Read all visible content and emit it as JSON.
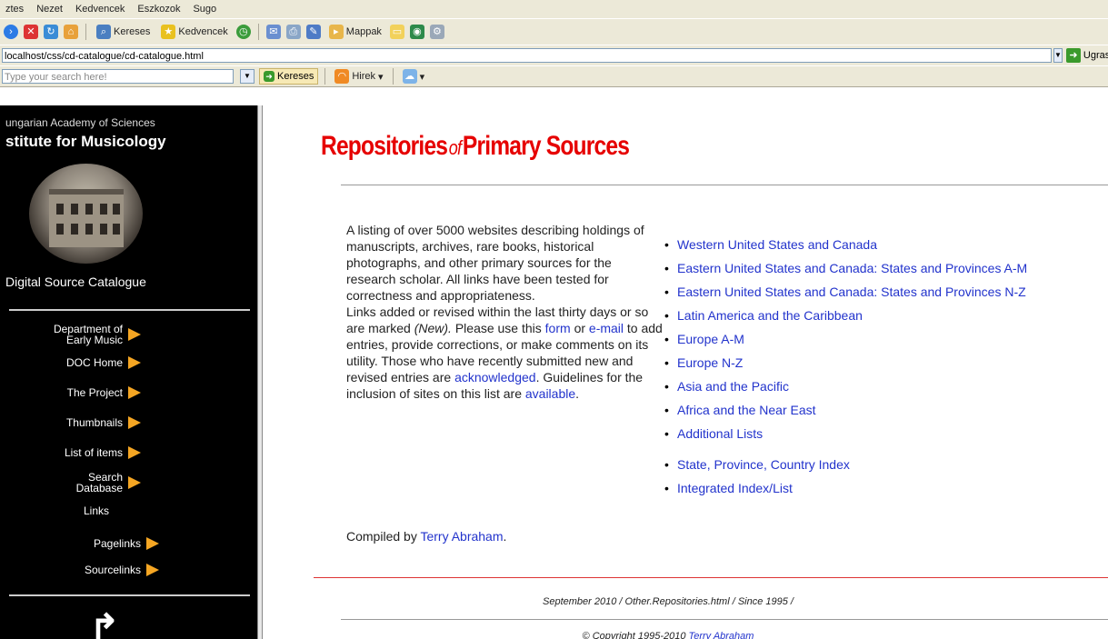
{
  "menu": [
    "ztes",
    "Nezet",
    "Kedvencek",
    "Eszkozok",
    "Sugo"
  ],
  "toolbar": {
    "search_label": "Kereses",
    "favorites_label": "Kedvencek",
    "media_label": "Mappak"
  },
  "address": {
    "url": "localhost/css/cd-catalogue/cd-catalogue.html",
    "go_label": "Ugras"
  },
  "searchbar": {
    "placeholder": "Type your search here!",
    "search_button": "Kereses",
    "news_label": "Hirek"
  },
  "sidebar": {
    "academy": "ungarian Academy of Sciences",
    "institute": "stitute for Musicology",
    "catalogue": "Digital Source Catalogue",
    "nav": [
      {
        "label_line1": "Department of",
        "label_line2": "Early Music"
      },
      {
        "label_line1": "DOC Home",
        "label_line2": ""
      },
      {
        "label_line1": "The Project",
        "label_line2": ""
      },
      {
        "label_line1": "Thumbnails",
        "label_line2": ""
      },
      {
        "label_line1": "List of items",
        "label_line2": ""
      },
      {
        "label_line1": "Search",
        "label_line2": "Database"
      },
      {
        "label_line1": "Links",
        "label_line2": ""
      },
      {
        "label_line1": "Pagelinks",
        "label_line2": ""
      },
      {
        "label_line1": "Sourcelinks",
        "label_line2": ""
      }
    ]
  },
  "main": {
    "title_part1": "Repositories",
    "title_of": "of",
    "title_part2": "Primary Sources",
    "intro": {
      "p1": "A listing of over 5000 websites describing holdings of manuscripts, archives, rare books, historical photographs, and other primary sources for the research scholar. All links have been tested for correctness and appropriateness.",
      "p2a": "Links added or revised within the last thirty days or so are marked",
      "new_marker": "(New).",
      "p2b": "Please use this",
      "form_link": "form",
      "p2c": "or",
      "email_link": "e-mail",
      "p2d": "to add entries, provide corrections, or make comments on its utility. Those who have recently submitted new and revised entries are",
      "ack_link": "acknowledged",
      "p2e": ". Guidelines for the inclusion of sites on this list are",
      "avail_link": "available",
      "p2f": "."
    },
    "compiled_prefix": "Compiled by",
    "compiled_name": "Terry Abraham",
    "links": [
      "Western United States and Canada",
      "Eastern United States and Canada: States and Provinces A-M",
      "Eastern United States and Canada: States and Provinces N-Z",
      "Latin America and the Caribbean",
      "Europe A-M",
      "Europe N-Z",
      "Asia and the Pacific",
      "Africa and the Near East",
      "Additional Lists"
    ],
    "index_links": [
      "State, Province, Country Index",
      "Integrated Index/List"
    ],
    "footer_line": "September 2010 / Other.Repositories.html / Since 1995 /",
    "copyright_prefix": "© Copyright 1995-2010",
    "copyright_name": "Terry Abraham"
  },
  "colors": {
    "title": "#e60000",
    "link": "#2233cc",
    "sidebar_bg": "#000000",
    "arrow": "#f5a623"
  }
}
